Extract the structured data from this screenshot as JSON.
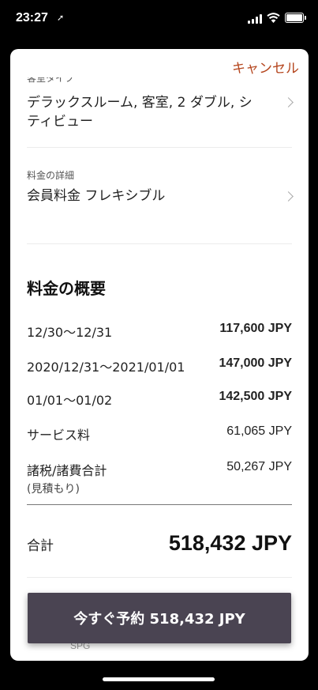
{
  "status_bar": {
    "time": "23:27",
    "location_arrow": "➚"
  },
  "header": {
    "cancel_label": "キャンセル"
  },
  "room": {
    "clipped_label": "客室タイプ",
    "title_line1": "デラックスルーム, 客室, 2 ダブル, シ",
    "title_line2": "ティビュー"
  },
  "rate": {
    "label": "料金の詳細",
    "value": "会員料金 フレキシブル"
  },
  "summary": {
    "title": "料金の概要",
    "rows": [
      {
        "label": "12/30～12/31",
        "value": "117,600 JPY"
      },
      {
        "label": "2020/12/31～2021/01/01",
        "value": "147,000 JPY"
      },
      {
        "label": "01/01～01/02",
        "value": "142,500 JPY"
      },
      {
        "label": "サービス料",
        "value": "61,065 JPY"
      },
      {
        "label": "諸税/諸費合計",
        "sub": "(見積もり)",
        "value": "50,267 JPY"
      }
    ],
    "total_label": "合計",
    "total_value": "518,432 JPY"
  },
  "footer": {
    "book_label": "今すぐ予約 518,432 JPY",
    "spg_text": "SPG"
  },
  "colors": {
    "accent": "#b5461e",
    "button_bg": "#4a4452"
  }
}
